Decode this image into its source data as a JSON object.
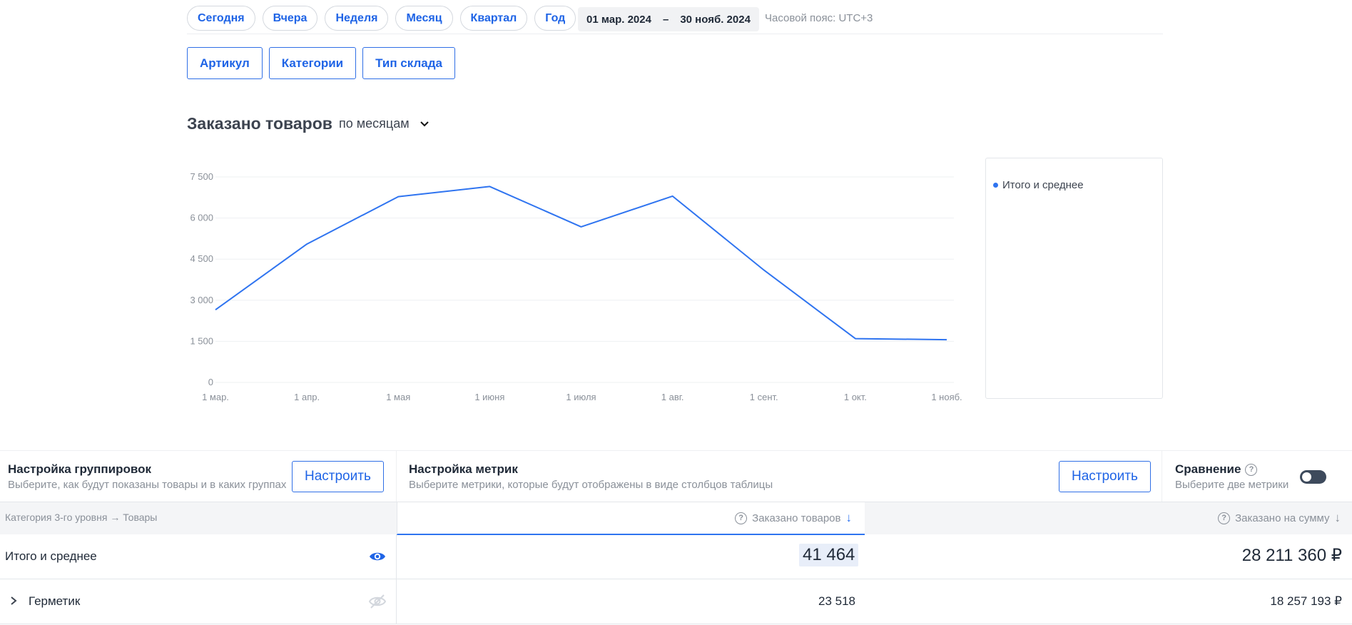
{
  "periods": [
    "Сегодня",
    "Вчера",
    "Неделя",
    "Месяц",
    "Квартал",
    "Год"
  ],
  "date_range": {
    "from": "01 мар. 2024",
    "dash": "–",
    "to": "30 нояб. 2024"
  },
  "timezone": "Часовой пояс: UTC+3",
  "filters": [
    "Артикул",
    "Категории",
    "Тип склада"
  ],
  "chart_header": {
    "title": "Заказано товаров",
    "period": "по месяцам",
    "icon": "chevron-down-icon"
  },
  "chart_data": {
    "type": "line",
    "categories": [
      "1 мар.",
      "1 апр.",
      "1 мая",
      "1 июня",
      "1 июля",
      "1 авг.",
      "1 сент.",
      "1 окт.",
      "1 нояб."
    ],
    "ytick_labels": [
      "0",
      "1 500",
      "3 000",
      "4 500",
      "6 000",
      "7 500"
    ],
    "yticks": [
      0,
      1500,
      3000,
      4500,
      6000,
      7500
    ],
    "ylim": [
      0,
      7500
    ],
    "grid": true,
    "legend_position": "right",
    "series": [
      {
        "name": "Итого и среднее",
        "color": "#2f74f0",
        "points": [
          {
            "x": 0,
            "y": 2650
          },
          {
            "x": 1,
            "y": 5050
          },
          {
            "x": 2,
            "y": 6780
          },
          {
            "x": 3,
            "y": 7150
          },
          {
            "x": 4,
            "y": 5680
          },
          {
            "x": 5,
            "y": 6800
          },
          {
            "x": 6,
            "y": 4100
          },
          {
            "x": 6.5,
            "y": 2850
          },
          {
            "x": 7,
            "y": 1600
          },
          {
            "x": 8,
            "y": 1560
          }
        ]
      }
    ]
  },
  "legend": {
    "label": "Итого и среднее"
  },
  "settings": {
    "grouping": {
      "title": "Настройка группировок",
      "subtitle": "Выберите, как будут показаны товары и в каких группах",
      "button": "Настроить"
    },
    "metrics": {
      "title": "Настройка метрик",
      "subtitle": "Выберите метрики, которые будут отображены в виде столбцов таблицы",
      "button": "Настроить"
    },
    "comparison": {
      "title": "Сравнение",
      "subtitle": "Выберите две метрики",
      "toggle_on": false
    }
  },
  "table": {
    "group_header": "Категория 3-го уровня → Товары",
    "columns": [
      "Заказано товаров",
      "Заказано на сумму"
    ],
    "rows": [
      {
        "label": "Итого и среднее",
        "ordered_qty": "41 464",
        "ordered_sum": "28 211 360 ₽",
        "visible": true
      },
      {
        "label": "Герметик",
        "ordered_qty": "23 518",
        "ordered_sum": "18 257 193 ₽",
        "visible": false
      }
    ]
  }
}
